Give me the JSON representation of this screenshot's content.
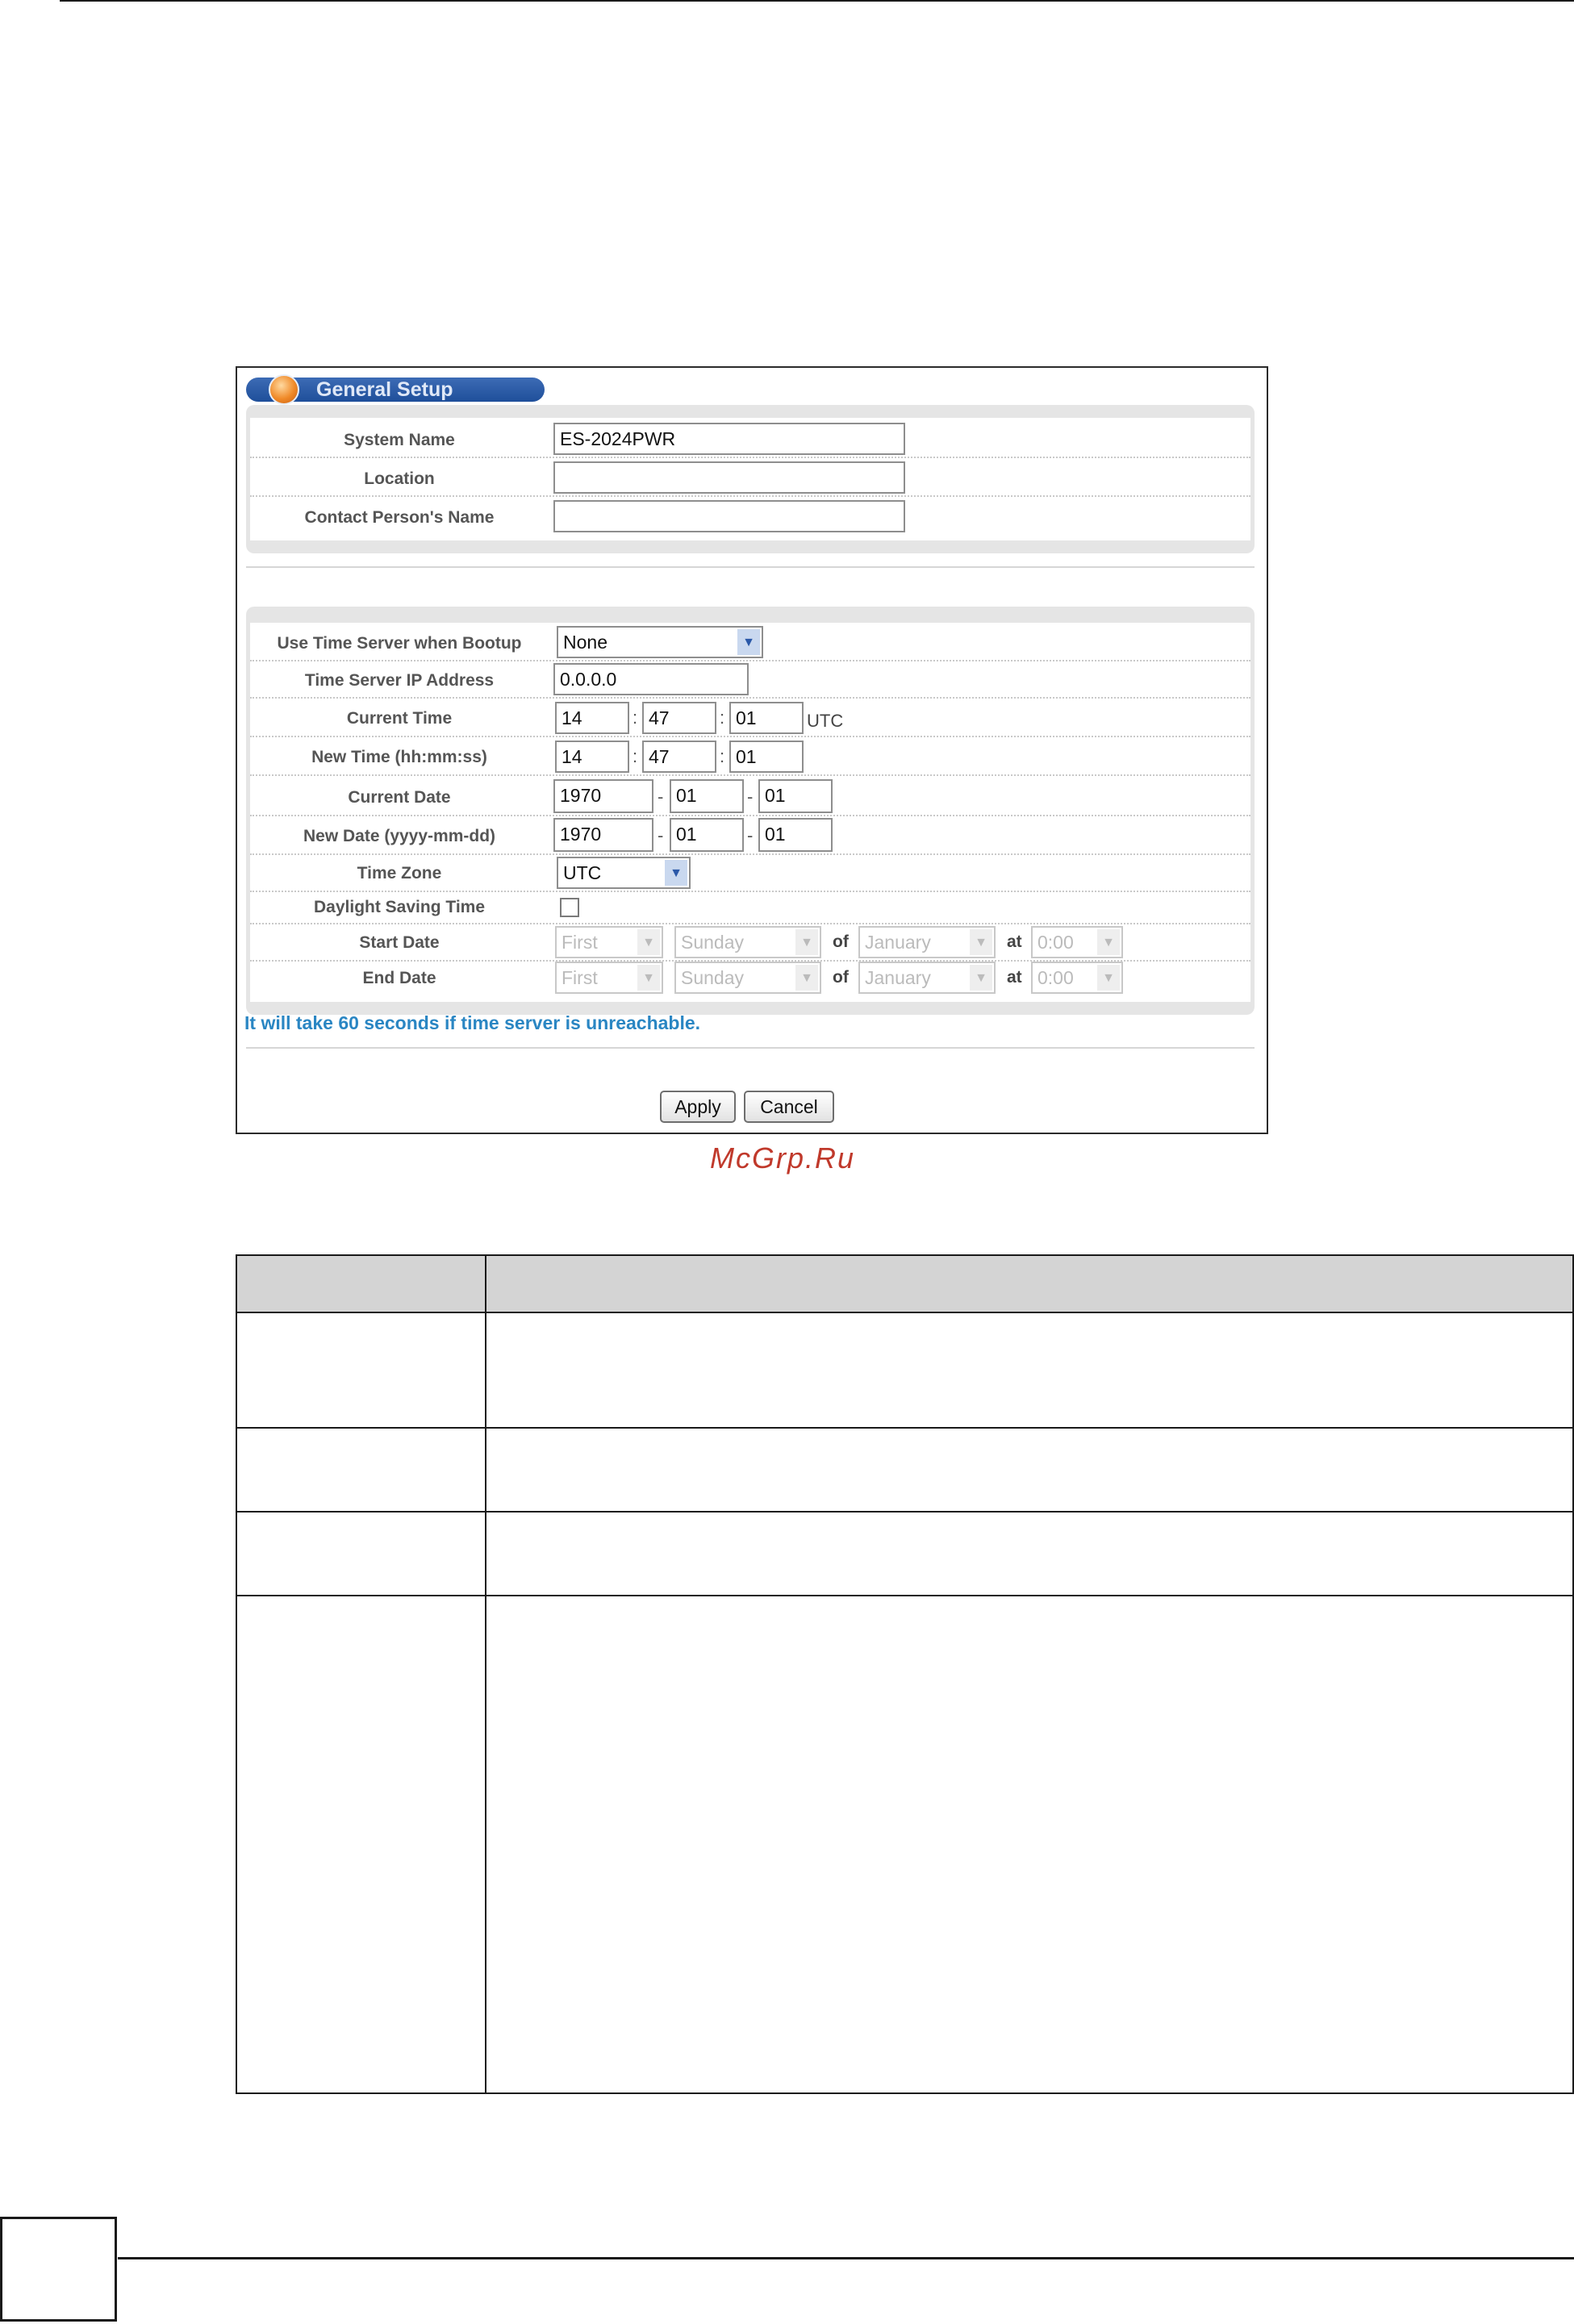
{
  "panel": {
    "title": "General Setup",
    "system_name_label": "System Name",
    "system_name_value": "ES-2024PWR",
    "location_label": "Location",
    "location_value": "",
    "contact_label": "Contact Person's Name",
    "contact_value": "",
    "time_server_label": "Use Time Server when Bootup",
    "time_server_selected": "None",
    "time_server_ip_label": "Time Server IP Address",
    "time_server_ip_value": "0.0.0.0",
    "current_time_label": "Current Time",
    "current_time": {
      "hh": "14",
      "mm": "47",
      "ss": "01"
    },
    "utc_suffix": "UTC",
    "new_time_label": "New Time (hh:mm:ss)",
    "new_time": {
      "hh": "14",
      "mm": "47",
      "ss": "01"
    },
    "current_date_label": "Current Date",
    "current_date": {
      "yyyy": "1970",
      "mm": "01",
      "dd": "01"
    },
    "new_date_label": "New Date (yyyy-mm-dd)",
    "new_date": {
      "yyyy": "1970",
      "mm": "01",
      "dd": "01"
    },
    "time_zone_label": "Time Zone",
    "time_zone_selected": "UTC",
    "dst_label": "Daylight Saving Time",
    "dst_checked": false,
    "start_date_label": "Start Date",
    "end_date_label": "End Date",
    "dst_week": "First",
    "dst_day": "Sunday",
    "of_text": "of",
    "dst_month": "January",
    "at_text": "at",
    "dst_time": "0:00",
    "time_sep": ":",
    "date_sep": "-",
    "note": "It will take 60 seconds if time server is unreachable.",
    "apply_label": "Apply",
    "cancel_label": "Cancel"
  },
  "watermark": "McGrp.Ru",
  "icons": {
    "dropdown": "chevron-down-icon",
    "title_bullet": "orange-bullet-icon",
    "checkbox": "checkbox-icon"
  },
  "colors": {
    "title_bar": "#2a5aa8",
    "note_text": "#2a86c3",
    "watermark": "#c0392b",
    "panel_bg": "#e5e5e5",
    "table_header": "#d4d4d4"
  }
}
